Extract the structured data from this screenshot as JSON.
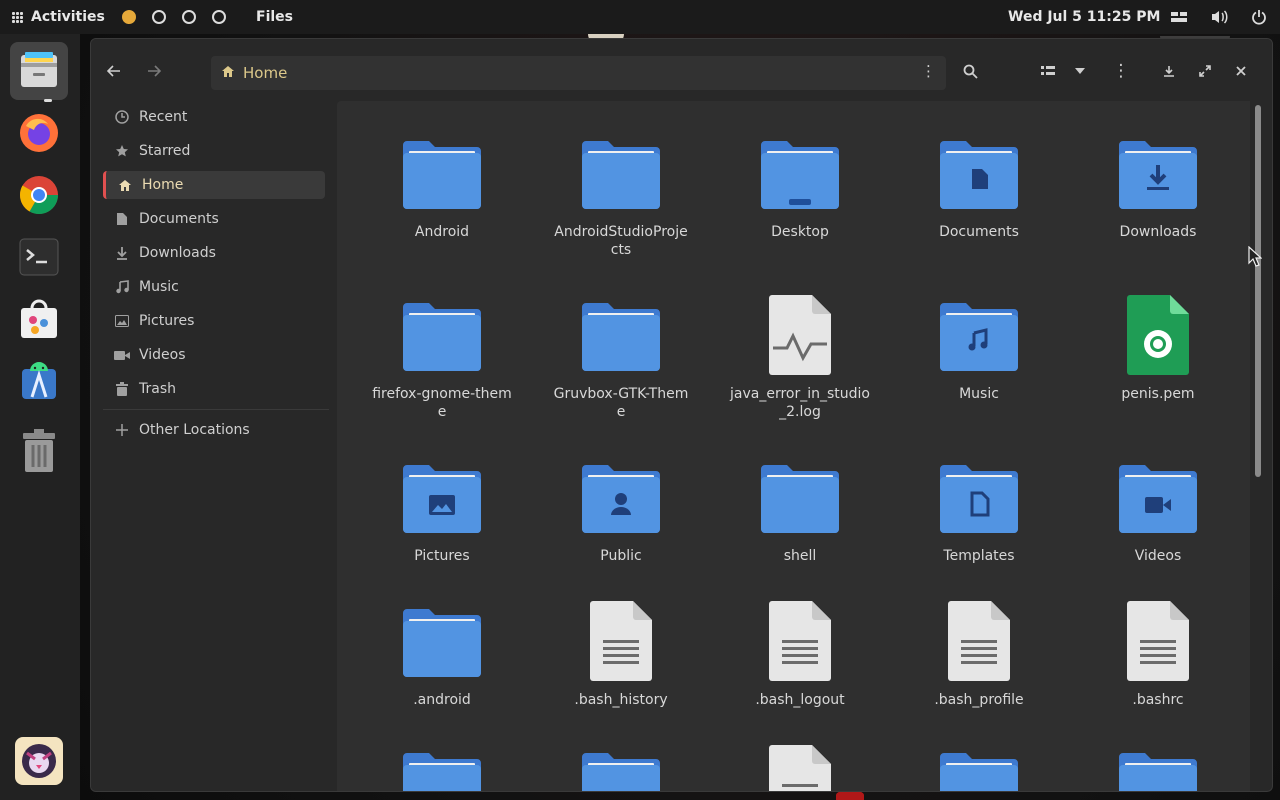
{
  "topbar": {
    "activities_label": "Activities",
    "app_name": "Files",
    "clock": "Wed Jul 5  11:25 PM"
  },
  "window": {
    "path": "Home"
  },
  "sidebar": {
    "items": [
      {
        "label": "Recent",
        "icon": "clock-icon"
      },
      {
        "label": "Starred",
        "icon": "star-icon"
      },
      {
        "label": "Home",
        "icon": "home-icon"
      },
      {
        "label": "Documents",
        "icon": "document-icon"
      },
      {
        "label": "Downloads",
        "icon": "download-icon"
      },
      {
        "label": "Music",
        "icon": "music-icon"
      },
      {
        "label": "Pictures",
        "icon": "picture-icon"
      },
      {
        "label": "Videos",
        "icon": "video-icon"
      },
      {
        "label": "Trash",
        "icon": "trash-icon"
      }
    ],
    "other_locations": "Other Locations"
  },
  "files": [
    {
      "name": "Android",
      "type": "folder"
    },
    {
      "name": "AndroidStudioProjects",
      "type": "folder"
    },
    {
      "name": "Desktop",
      "type": "folder-desktop"
    },
    {
      "name": "Documents",
      "type": "folder-documents"
    },
    {
      "name": "Downloads",
      "type": "folder-downloads"
    },
    {
      "name": "firefox-gnome-theme",
      "type": "folder"
    },
    {
      "name": "Gruvbox-GTK-Theme",
      "type": "folder"
    },
    {
      "name": "java_error_in_studio_2.log",
      "type": "log"
    },
    {
      "name": "Music",
      "type": "folder-music"
    },
    {
      "name": "penis.pem",
      "type": "certificate"
    },
    {
      "name": "Pictures",
      "type": "folder-pictures"
    },
    {
      "name": "Public",
      "type": "folder-public"
    },
    {
      "name": "shell",
      "type": "folder"
    },
    {
      "name": "Templates",
      "type": "folder-templates"
    },
    {
      "name": "Videos",
      "type": "folder-videos"
    },
    {
      "name": ".android",
      "type": "folder"
    },
    {
      "name": ".bash_history",
      "type": "text"
    },
    {
      "name": ".bash_logout",
      "type": "text"
    },
    {
      "name": ".bash_profile",
      "type": "text"
    },
    {
      "name": ".bashrc",
      "type": "text"
    }
  ],
  "colors": {
    "folder": "#5294e2",
    "folder_dark": "#3e7ad0",
    "accent": "#e6a93a"
  }
}
